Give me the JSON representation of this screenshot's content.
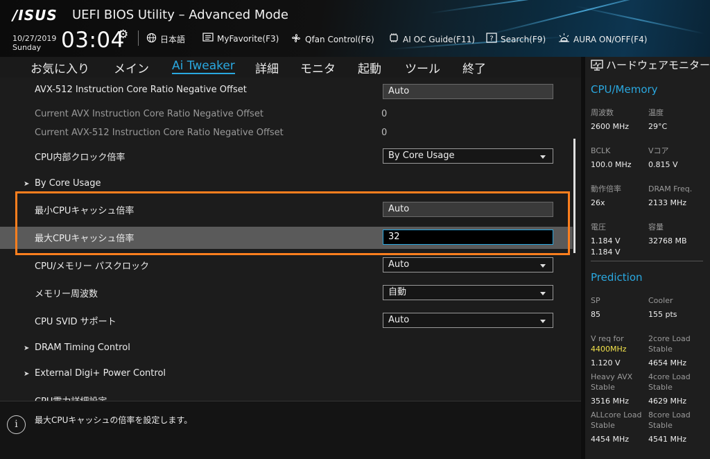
{
  "header": {
    "logo": "/ISUS",
    "title": "UEFI BIOS Utility – Advanced Mode",
    "date": "10/27/2019",
    "day": "Sunday",
    "time": "03:04",
    "language": "日本語",
    "myfavorite": "MyFavorite(F3)",
    "qfan": "Qfan Control(F6)",
    "aioc": "AI OC Guide(F11)",
    "search": "Search(F9)",
    "aura": "AURA ON/OFF(F4)"
  },
  "tabs": [
    "お気に入り",
    "メイン",
    "Ai Tweaker",
    "詳細",
    "モニタ",
    "起動",
    "ツール",
    "終了"
  ],
  "active_tab": "Ai Tweaker",
  "settings": [
    {
      "label": "AVX-512 Instruction Core Ratio Negative Offset",
      "value": "Auto"
    },
    {
      "label": "Current AVX Instruction Core Ratio Negative Offset",
      "value": "0"
    },
    {
      "label": "Current AVX-512 Instruction Core Ratio Negative Offset",
      "value": "0"
    },
    {
      "label": "CPU内部クロック倍率",
      "value": "By Core Usage"
    },
    {
      "label": "By Core Usage"
    },
    {
      "label": "最小CPUキャッシュ倍率",
      "value": "Auto"
    },
    {
      "label": "最大CPUキャッシュ倍率",
      "value": "32"
    },
    {
      "label": "CPU/メモリー パスクロック",
      "value": "Auto"
    },
    {
      "label": "メモリー周波数",
      "value": "自動"
    },
    {
      "label": "CPU SVID サポート",
      "value": "Auto"
    },
    {
      "label": "DRAM Timing Control"
    },
    {
      "label": "External Digi+ Power Control"
    },
    {
      "label": "CPU電力詳細設定"
    }
  ],
  "help": {
    "text": "最大CPUキャッシュの倍率を設定します。"
  },
  "hwmonitor": {
    "title": "ハードウェアモニター",
    "cpu_memory": {
      "title": "CPU/Memory",
      "freq_label": "周波数",
      "freq": "2600 MHz",
      "temp_label": "温度",
      "temp": "29°C",
      "bclk_label": "BCLK",
      "bclk": "100.0 MHz",
      "vcore_label": "Vコア",
      "vcore": "0.815 V",
      "ratio_label": "動作倍率",
      "ratio": "26x",
      "dram_label": "DRAM Freq.",
      "dram": "2133 MHz",
      "volt_label": "電圧",
      "volt1": "1.184 V",
      "volt2": "1.184 V",
      "cap_label": "容量",
      "cap": "32768 MB"
    },
    "prediction": {
      "title": "Prediction",
      "sp_label": "SP",
      "sp": "85",
      "cooler_label": "Cooler",
      "cooler": "155 pts",
      "vreq_label": "V req for",
      "vreq_freq": "4400MHz",
      "vreq": "1.120 V",
      "c2_label1": "2core Load",
      "c2_label2": "Stable",
      "c2": "4654 MHz",
      "heavy_label1": "Heavy AVX",
      "heavy_label2": "Stable",
      "heavy": "3516 MHz",
      "c4_label1": "4core Load",
      "c4_label2": "Stable",
      "c4": "4629 MHz",
      "all_label1": "ALLcore Load",
      "all_label2": "Stable",
      "all": "4454 MHz",
      "c8_label1": "8core Load",
      "c8_label2": "Stable",
      "c8": "4541 MHz"
    }
  },
  "colors": {
    "accent": "#2aa8e0",
    "highlight_box": "#ff7f1e",
    "freq_highlight": "#f2e24b"
  }
}
